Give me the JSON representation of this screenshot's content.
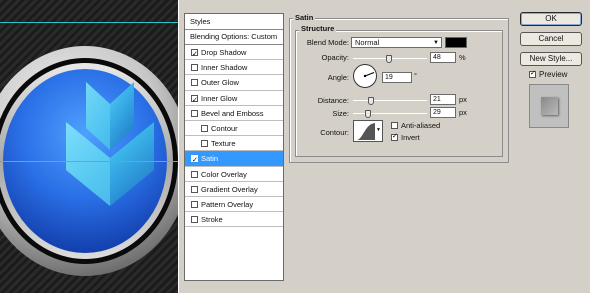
{
  "styles": {
    "header": "Styles",
    "blending": "Blending Options: Custom",
    "items": [
      {
        "label": "Drop Shadow",
        "checked": true
      },
      {
        "label": "Inner Shadow",
        "checked": false
      },
      {
        "label": "Outer Glow",
        "checked": false
      },
      {
        "label": "Inner Glow",
        "checked": true
      },
      {
        "label": "Bevel and Emboss",
        "checked": false
      },
      {
        "label": "Contour",
        "checked": false
      },
      {
        "label": "Texture",
        "checked": false
      },
      {
        "label": "Satin",
        "checked": true
      },
      {
        "label": "Color Overlay",
        "checked": false
      },
      {
        "label": "Gradient Overlay",
        "checked": false
      },
      {
        "label": "Pattern Overlay",
        "checked": false
      },
      {
        "label": "Stroke",
        "checked": false
      }
    ]
  },
  "satin": {
    "title": "Satin",
    "structure": "Structure",
    "blend_mode_label": "Blend Mode:",
    "blend_mode": "Normal",
    "color": "#000000",
    "opacity_label": "Opacity:",
    "opacity": "48",
    "opacity_unit": "%",
    "angle_label": "Angle:",
    "angle": "19",
    "angle_unit": "°",
    "distance_label": "Distance:",
    "distance": "21",
    "distance_unit": "px",
    "size_label": "Size:",
    "size": "29",
    "size_unit": "px",
    "contour_label": "Contour:",
    "anti_aliased_label": "Anti-aliased",
    "anti_aliased": false,
    "invert_label": "Invert",
    "invert": true
  },
  "buttons": {
    "ok": "OK",
    "cancel": "Cancel",
    "new_style": "New Style...",
    "preview_label": "Preview",
    "preview_checked": true
  },
  "colors": {
    "selection": "#3399ff",
    "dialog_bg": "#d4d0c8",
    "guide": "#29c7c0"
  }
}
